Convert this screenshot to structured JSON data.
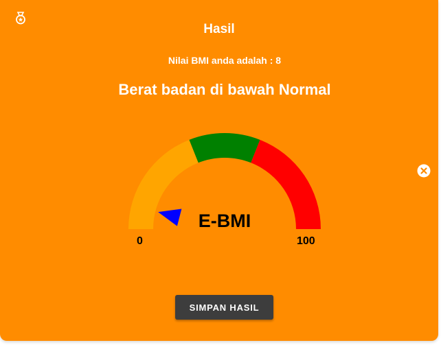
{
  "dialog": {
    "title": "Hasil",
    "bmi_text": "Nilai BMI anda adalah : 8",
    "category": "Berat badan di bawah Normal",
    "save_label": "SIMPAN HASIL",
    "corner_icon": "medal-icon",
    "close_icon": "close-circle-icon"
  },
  "gauge": {
    "center_label": "E-BMI",
    "min_label": "0",
    "max_label": "100",
    "min": 0,
    "max": 100,
    "needle_value": 8,
    "segments": [
      {
        "from": 0,
        "to": 38,
        "color": "#ffa500"
      },
      {
        "from": 38,
        "to": 62,
        "color": "#008000"
      },
      {
        "from": 62,
        "to": 100,
        "color": "#ff0000"
      }
    ],
    "needle_color": "#0000ff"
  },
  "colors": {
    "background": "#ff8c00",
    "button": "#3d3d3d",
    "text": "#ffffff"
  }
}
